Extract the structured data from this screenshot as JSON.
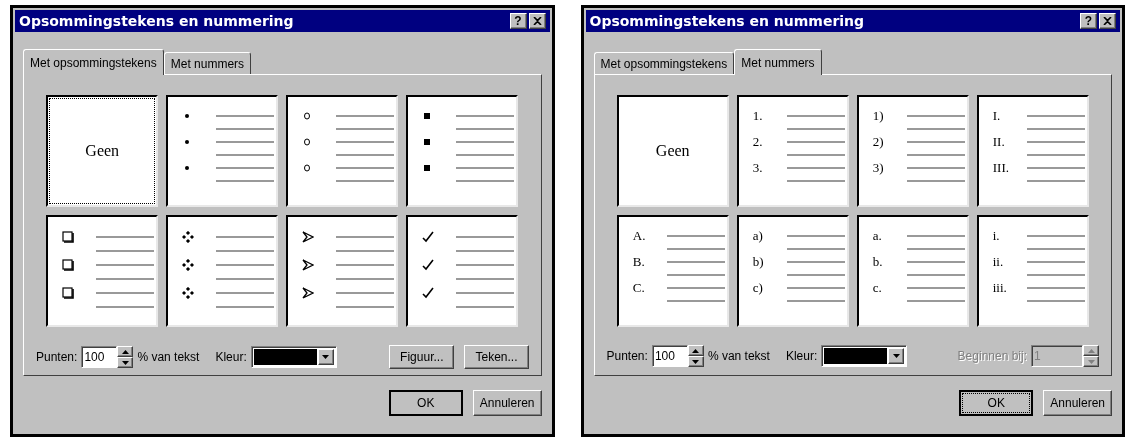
{
  "dialogs": [
    {
      "title": "Opsommingstekens en nummering",
      "help": "?",
      "tabs": [
        {
          "label": "Met opsommingstekens",
          "selected": true
        },
        {
          "label": "Met nummers",
          "selected": false
        }
      ],
      "options": [
        {
          "kind": "none",
          "label": "Geen",
          "selected": true
        },
        {
          "kind": "dot",
          "selected": false
        },
        {
          "kind": "circle",
          "selected": false
        },
        {
          "kind": "square",
          "selected": false
        },
        {
          "kind": "box",
          "selected": false
        },
        {
          "kind": "diamond",
          "selected": false
        },
        {
          "kind": "arrow",
          "selected": false
        },
        {
          "kind": "check",
          "selected": false
        }
      ],
      "size": {
        "label": "Punten:",
        "value": "100",
        "suffix": "% van tekst"
      },
      "color_field": {
        "label": "Kleur:",
        "color": "#000000"
      },
      "actions": [
        {
          "label": "Figuur..."
        },
        {
          "label": "Teken..."
        }
      ],
      "buttons": [
        {
          "label": "OK",
          "focused": false
        },
        {
          "label": "Annuleren",
          "focused": false
        }
      ]
    },
    {
      "title": "Opsommingstekens en nummering",
      "help": "?",
      "tabs": [
        {
          "label": "Met opsommingstekens",
          "selected": false
        },
        {
          "label": "Met nummers",
          "selected": true
        }
      ],
      "options": [
        {
          "kind": "none",
          "label": "Geen",
          "selected": false
        },
        {
          "kind": "number",
          "markers": [
            "1.",
            "2.",
            "3."
          ],
          "selected": false
        },
        {
          "kind": "number",
          "markers": [
            "1)",
            "2)",
            "3)"
          ],
          "selected": false
        },
        {
          "kind": "number",
          "markers": [
            "I.",
            "II.",
            "III."
          ],
          "selected": false
        },
        {
          "kind": "number",
          "markers": [
            "A.",
            "B.",
            "C."
          ],
          "selected": false
        },
        {
          "kind": "number",
          "markers": [
            "a)",
            "b)",
            "c)"
          ],
          "selected": false
        },
        {
          "kind": "number",
          "markers": [
            "a.",
            "b.",
            "c."
          ],
          "selected": false
        },
        {
          "kind": "number",
          "markers": [
            "i.",
            "ii.",
            "iii."
          ],
          "selected": false
        }
      ],
      "size": {
        "label": "Punten:",
        "value": "100",
        "suffix": "% van tekst"
      },
      "color_field": {
        "label": "Kleur:",
        "color": "#000000"
      },
      "start": {
        "label": "Beginnen bij:",
        "value": "1",
        "disabled": true
      },
      "buttons": [
        {
          "label": "OK",
          "focused": true
        },
        {
          "label": "Annuleren",
          "focused": false
        }
      ]
    }
  ]
}
